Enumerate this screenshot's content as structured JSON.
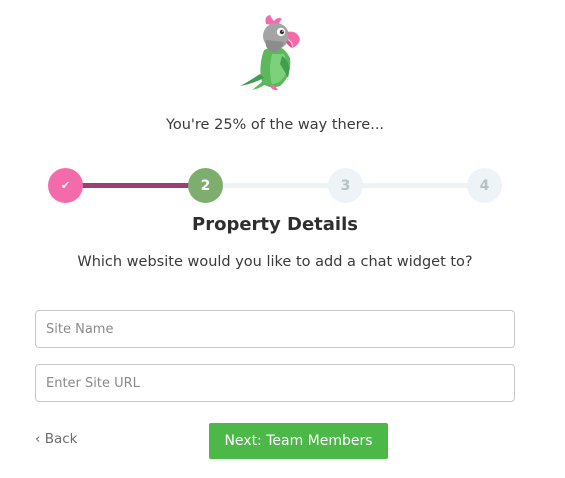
{
  "header": {
    "logo_icon": "parrot-icon"
  },
  "progress": {
    "text": "You're 25% of the way there...",
    "percent": 25,
    "completed_color": "#9b3f78",
    "steps": [
      {
        "label": "✔",
        "state": "completed",
        "color": "#f46bab"
      },
      {
        "label": "2",
        "state": "current",
        "color": "#7eae6e"
      },
      {
        "label": "3",
        "state": "upcoming",
        "color": "#edf3f6"
      },
      {
        "label": "4",
        "state": "upcoming",
        "color": "#edf3f6"
      }
    ]
  },
  "form": {
    "title": "Property Details",
    "subtitle": "Which website would you like to add a chat widget to?",
    "site_name": {
      "placeholder": "Site Name",
      "value": ""
    },
    "site_url": {
      "placeholder": "Enter Site URL",
      "value": ""
    }
  },
  "actions": {
    "back_label": "‹ Back",
    "next_label": "Next: Team Members",
    "next_color": "#4cb847"
  }
}
